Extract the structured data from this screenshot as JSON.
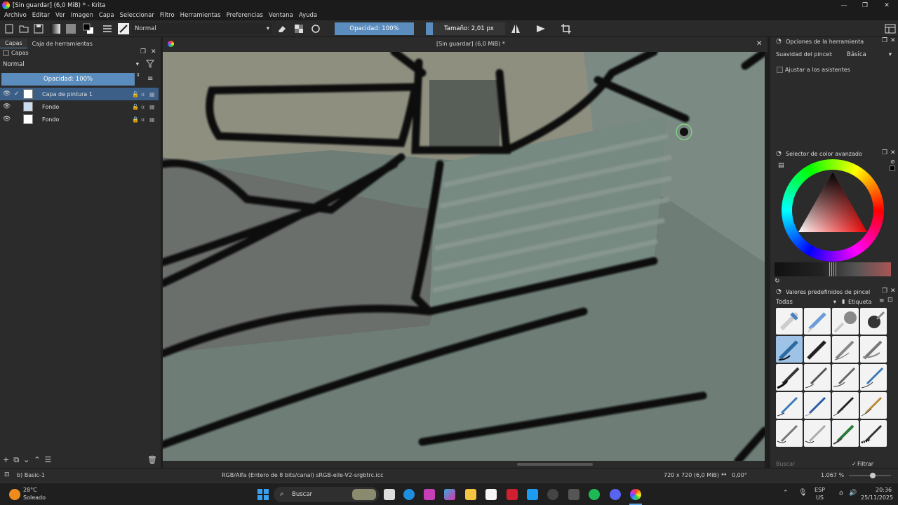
{
  "window": {
    "title": "[Sin guardar]  (6,0 MiB) * - Krita",
    "controls": [
      "—",
      "❐",
      "✕"
    ]
  },
  "menu": [
    "Archivo",
    "Editar",
    "Ver",
    "Imagen",
    "Capa",
    "Seleccionar",
    "Filtro",
    "Herramientas",
    "Preferencias",
    "Ventana",
    "Ayuda"
  ],
  "toolbar": {
    "blend_mode": "Normal",
    "opacity": "Opacidad: 100%",
    "size": "Tamaño: 2,01 px"
  },
  "left_dock": {
    "tabs": [
      "Capas",
      "Caja de herramientas"
    ],
    "panel_title": "Capas",
    "blend_mode": "Normal",
    "opacity": "Opacidad:  100%",
    "layers": [
      {
        "name": "Capa de pintura 1",
        "selected": true
      },
      {
        "name": "Fondo",
        "selected": false
      },
      {
        "name": "Fondo",
        "selected": false
      }
    ]
  },
  "canvas": {
    "doc_title": "[Sin guardar]  (6,0 MiB) *"
  },
  "right_dock": {
    "tool_options_title": "Opciones de la herramienta",
    "smoothing_label": "Suavidad del pincel:",
    "smoothing_value": "Básica",
    "assistants_label": "Ajustar a los asistentes",
    "color_selector_title": "Selector de color avanzado",
    "presets_title": "Valores predefinidos de pincel",
    "presets_filter": "Todas",
    "presets_tag": "Etiqueta",
    "search_placeholder": "Buscar",
    "filter_tag_label": "Filtrar etiqueta",
    "accent": "#5a8cbd"
  },
  "status": {
    "brush": "b) Basic-1",
    "color_space": "RGB/Alfa (Entero de 8 bits/canal)  sRGB-elle-V2-srgbtrc.icc",
    "dimensions": "720 x 720 (6,0 MiB)",
    "rotation": "0,00°",
    "zoom": "1.067 %"
  },
  "taskbar": {
    "weather_temp": "28°C",
    "weather_desc": "Soleado",
    "search_label": "Buscar",
    "lang1": "ESP",
    "lang2": "US",
    "time": "20:36",
    "date": "25/11/2025"
  }
}
